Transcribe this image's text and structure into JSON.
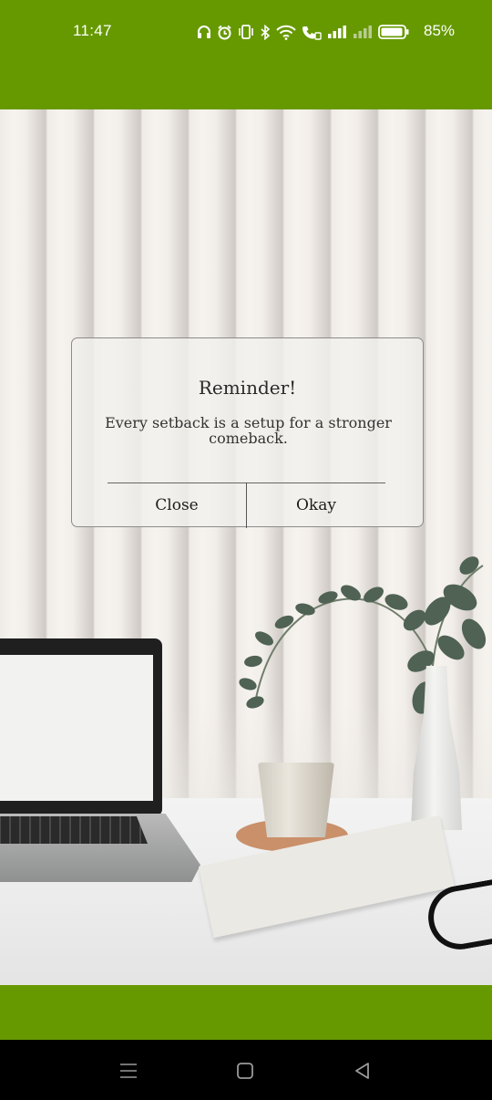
{
  "status_bar": {
    "time": "11:47",
    "battery_percent": "85%",
    "icons": [
      "headphones-icon",
      "alarm-icon",
      "vibrate-icon",
      "bluetooth-icon",
      "wifi-icon",
      "volte-call-icon",
      "signal-icon",
      "signal-icon-2",
      "battery-icon"
    ]
  },
  "dialog": {
    "title": "Reminder!",
    "message": "Every setback is a setup for a stronger comeback.",
    "close_label": "Close",
    "okay_label": "Okay"
  },
  "nav_bar": {
    "buttons": [
      "recents-icon",
      "home-icon",
      "back-icon"
    ]
  },
  "colors": {
    "accent": "#669900",
    "nav_background": "#000000"
  }
}
